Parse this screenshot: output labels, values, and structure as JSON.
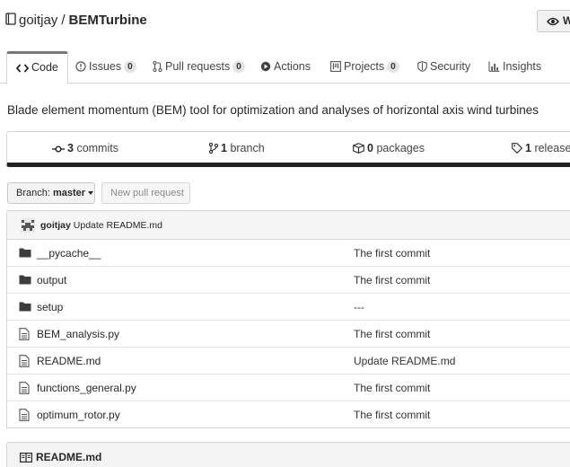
{
  "repo": {
    "owner": "goitjay",
    "separator": "/",
    "name": "BEMTurbine"
  },
  "watch": {
    "label": "W"
  },
  "tabs": [
    {
      "label": "Code",
      "icon": "code-icon"
    },
    {
      "label": "Issues",
      "count": "0",
      "icon": "issue-icon"
    },
    {
      "label": "Pull requests",
      "count": "0",
      "icon": "pull-request-icon"
    },
    {
      "label": "Actions",
      "icon": "play-icon"
    },
    {
      "label": "Projects",
      "count": "0",
      "icon": "project-icon"
    },
    {
      "label": "Security",
      "icon": "shield-icon"
    },
    {
      "label": "Insights",
      "icon": "graph-icon"
    }
  ],
  "description": "Blade element momentum (BEM) tool for optimization and analyses of horizontal axis wind turbines",
  "summary": {
    "commits": {
      "count": "3",
      "label": "commits"
    },
    "branches": {
      "count": "1",
      "label": "branch"
    },
    "packages": {
      "count": "0",
      "label": "packages"
    },
    "releases": {
      "count": "1",
      "label": "release"
    }
  },
  "branch_button": {
    "prefix": "Branch:",
    "value": "master"
  },
  "new_pr_button": {
    "label": "New pull request"
  },
  "latest_commit": {
    "author": "goitjay",
    "message": "Update README.md"
  },
  "files": [
    {
      "name": "__pycache__",
      "type": "folder",
      "message": "The first commit"
    },
    {
      "name": "output",
      "type": "folder",
      "message": "The first commit"
    },
    {
      "name": "setup",
      "type": "folder",
      "message": "---"
    },
    {
      "name": "BEM_analysis.py",
      "type": "file",
      "message": "The first commit"
    },
    {
      "name": "README.md",
      "type": "file",
      "message": "Update README.md"
    },
    {
      "name": "functions_general.py",
      "type": "file",
      "message": "The first commit"
    },
    {
      "name": "optimum_rotor.py",
      "type": "file",
      "message": "The first commit"
    }
  ],
  "readme": {
    "title": "README.md"
  }
}
